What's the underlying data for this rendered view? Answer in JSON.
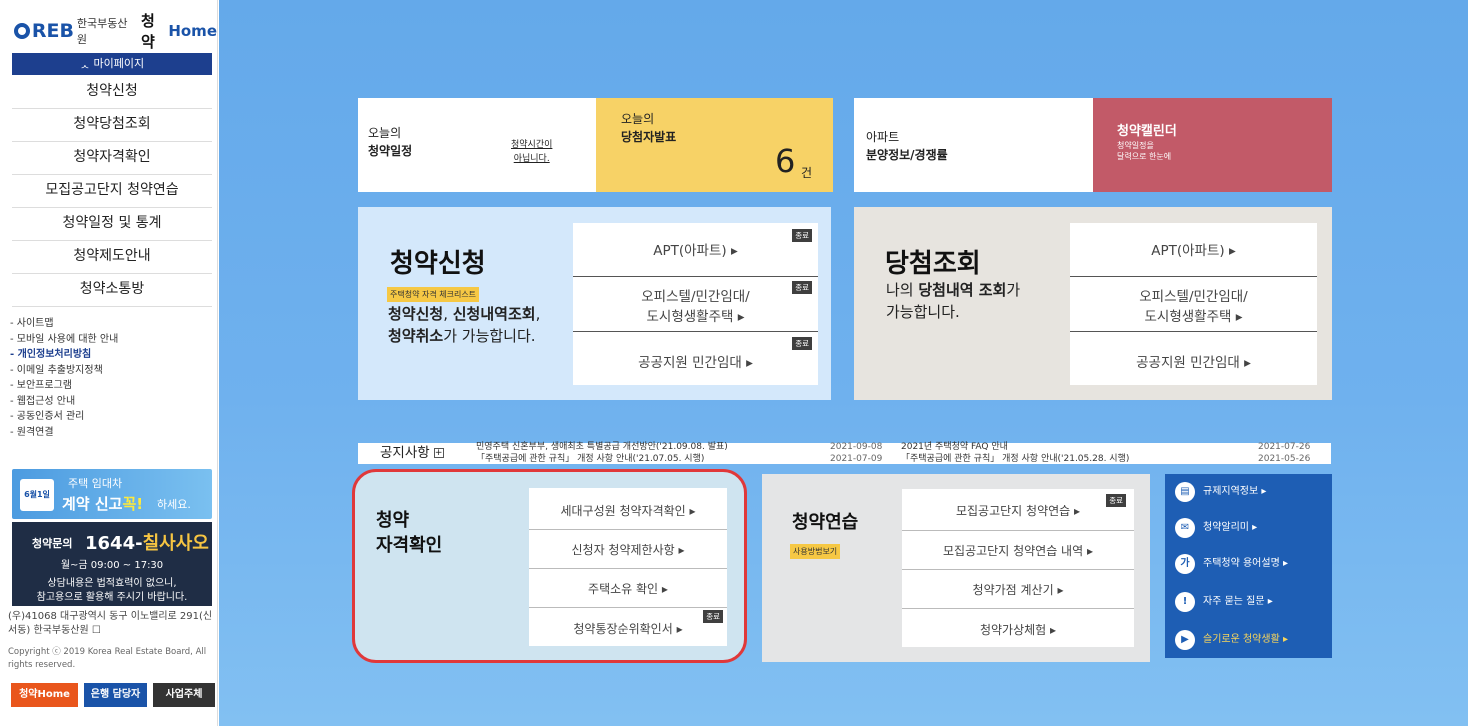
{
  "logo": {
    "reb": "REB",
    "org": "한국부동산원",
    "brand": "청약",
    "home": "Home"
  },
  "sidebar": {
    "mypage": "ᆺ 마이페이지",
    "menu": [
      "청약신청",
      "청약당첨조회",
      "청약자격확인",
      "모집공고단지 청약연습",
      "청약일정 및 통계",
      "청약제도안내",
      "청약소통방"
    ],
    "links": [
      "- 사이트맵",
      "- 모바일 사용에 대한 안내",
      "- 개인정보처리방침",
      "- 이메일 추출방지정책",
      "- 보안프로그램",
      "- 웹접근성 안내",
      "- 공동인증서 관리",
      "- 원격연결"
    ],
    "banner": {
      "cal": "6월1일",
      "line1": "주택 임대차",
      "line2a": "계약 신고",
      "line2b": "꼭!",
      "line3": "하세요."
    },
    "call": {
      "q": "청약문의",
      "num_a": "1644-",
      "num_b": "칠사사오",
      "hours": "월~금 09:00 ~ 17:30",
      "note1": "상담내용은 법적효력이 없으니,",
      "note2": "참고용으로 활용해 주시기 바랍니다."
    },
    "address": "(우)41068 대구광역시 동구 이노밸리로 291(신서동) 한국부동산원 ☐",
    "copyright": "Copyright ⓒ 2019 Korea Real Estate Board, All rights reserved.",
    "buttons": [
      "청약Home",
      "은행 담당자",
      "사업주체"
    ]
  },
  "top": {
    "today": {
      "l1": "오늘의",
      "l2": "청약일정",
      "link1": "청약시간이",
      "link2": "아닙니다."
    },
    "winner": {
      "l1": "오늘의",
      "l2": "당첨자발표",
      "count": "6",
      "unit": "건"
    },
    "apt": {
      "l1": "아파트",
      "l2": "분양정보/경쟁률"
    },
    "calendar": {
      "l1": "청약캘린더",
      "l2a": "청약일정을",
      "l2b": "달력으로 한눈에"
    }
  },
  "apply": {
    "title": "청약신청",
    "tag": "주택청약 자격 체크리스트",
    "desc_b1": "청약신청",
    "desc_1": ", ",
    "desc_b2": "신청내역조회",
    "desc_2": ",",
    "desc_b3": "청약취소",
    "desc_3": "가 가능합니다.",
    "options": [
      "APT(아파트) ▸",
      "오피스텔/민간임대/",
      "도시형생활주택   ▸",
      "공공지원 민간임대 ▸"
    ],
    "closed": "종료"
  },
  "result": {
    "title": "당첨조회",
    "desc_1": "나의 ",
    "desc_b1": "당첨내역 조회",
    "desc_2": "가",
    "desc_3": "가능합니다.",
    "options": [
      "APT(아파트) ▸",
      "오피스텔/민간임대/",
      "도시형생활주택   ▸",
      "공공지원 민간임대 ▸"
    ]
  },
  "notice": {
    "label": "공지사항",
    "plus": "+",
    "rows": [
      {
        "text": "민영주택 신혼부부, 생애최초 특별공급 개선방안('21.09.08. 발표)",
        "date": "2021-09-08"
      },
      {
        "text": "「주택공급에 관한 규칙」 개정 사항 안내('21.07.05. 시행)",
        "date": "2021-07-09"
      },
      {
        "text": "2021년 주택청약 FAQ 안내",
        "date": "2021-07-26"
      },
      {
        "text": "「주택공급에 관한 규칙」 개정 사항 안내('21.05.28. 시행)",
        "date": "2021-05-26"
      }
    ]
  },
  "qualify": {
    "title1": "청약",
    "title2": "자격확인",
    "options": [
      "세대구성원 청약자격확인 ▸",
      "신청자 청약제한사항 ▸",
      "주택소유 확인 ▸",
      "청약통장순위확인서 ▸"
    ],
    "closed": "종료"
  },
  "practice": {
    "title": "청약연습",
    "tag": "사용방법보기",
    "options": [
      "모집공고단지 청약연습 ▸",
      "모집공고단지 청약연습 내역 ▸",
      "청약가점 계산기 ▸",
      "청약가상체험 ▸"
    ],
    "closed": "종료"
  },
  "quicklinks": [
    {
      "icon": "▤",
      "label": "규제지역정보 ▸"
    },
    {
      "icon": "✉",
      "label": "청약알리미 ▸"
    },
    {
      "icon": "가",
      "label": "주택청약 용어설명 ▸"
    },
    {
      "icon": "!",
      "label": "자주 묻는 질문 ▸"
    },
    {
      "icon": "▶",
      "label": "슬기로운 청약생활 ▸"
    }
  ],
  "colors": {
    "navy": "#1d3f8e",
    "yellow": "#f7d266",
    "rose": "#c25a68",
    "highlight": "#e0383a"
  }
}
